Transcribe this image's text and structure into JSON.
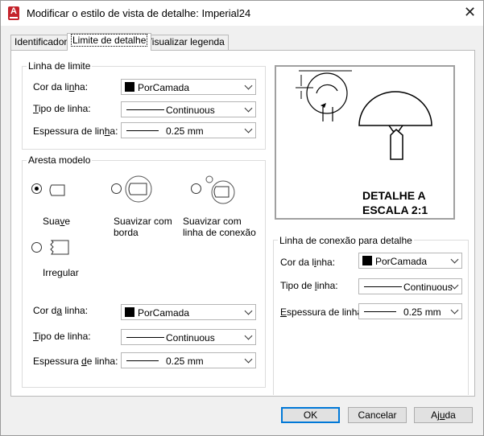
{
  "window": {
    "title": "Modificar o estilo de vista de detalhe: Imperial24",
    "close_symbol": "✕"
  },
  "tabs": [
    {
      "label": "Identificador"
    },
    {
      "label": "Limite de detalhe"
    },
    {
      "label": "Visualizar legenda"
    }
  ],
  "boundary_line": {
    "title": "Linha de limite",
    "color_label": "Cor da linha:",
    "color_value": "PorCamada",
    "type_label": "Tipo de linha:",
    "type_value": "Continuous",
    "weight_label": "Espessura de linha:",
    "weight_value": "0.25 mm"
  },
  "model_edge": {
    "title": "Aresta modelo",
    "options": [
      {
        "label": "Suave",
        "selected": true
      },
      {
        "label": "Suavizar com borda",
        "selected": false
      },
      {
        "label": "Suavizar com linha de conexão",
        "selected": false
      },
      {
        "label": "Irregular",
        "selected": false
      }
    ],
    "color_label": "Cor da linha:",
    "color_value": "PorCamada",
    "type_label": "Tipo de linha:",
    "type_value": "Continuous",
    "weight_label": "Espessura de linha:",
    "weight_value": "0.25 mm"
  },
  "preview": {
    "line1": "DETALHE A",
    "line2": "ESCALA 2:1"
  },
  "connection_line": {
    "title": "Linha de conexão para detalhe",
    "color_label": "Cor da linha:",
    "color_value": "PorCamada",
    "type_label": "Tipo de linha:",
    "type_value": "Continuous",
    "weight_label": "Espessura de linha:",
    "weight_value": "0.25 mm"
  },
  "buttons": {
    "ok": "OK",
    "cancel": "Cancelar",
    "help": "Ajuda"
  },
  "colors": {
    "accent": "#0078d7",
    "app_icon": "#c4232b"
  }
}
